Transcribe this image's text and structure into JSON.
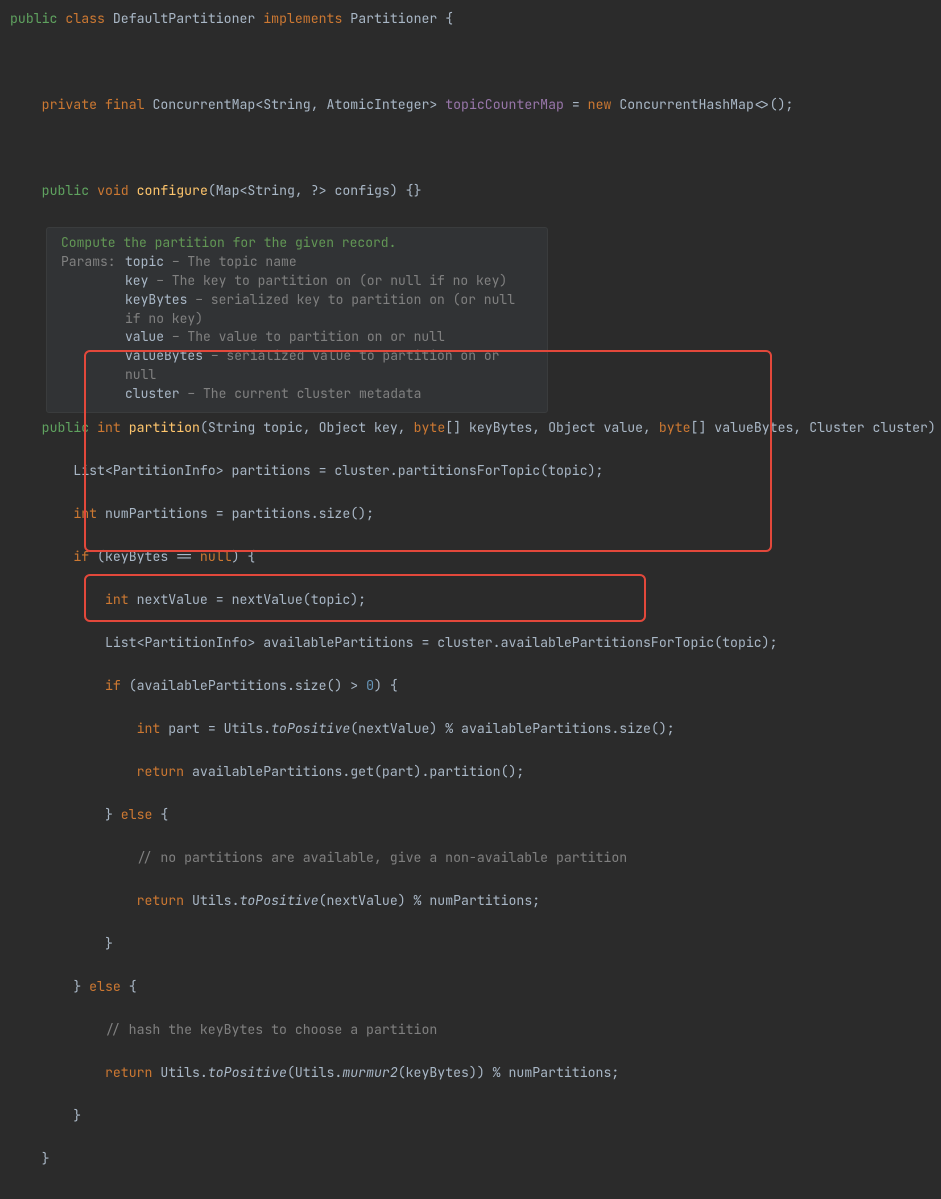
{
  "classDecl": {
    "public": "public",
    "class": "class",
    "name": "DefaultPartitioner",
    "implements": "implements",
    "iface": "Partitioner",
    "open": " {"
  },
  "fieldDecl": {
    "private": "private",
    "final": "final",
    "type": "ConcurrentMap<String, AtomicInteger>",
    "name": "topicCounterMap",
    "eq": " = ",
    "new": "new",
    "ctor": "ConcurrentHashMap<>();"
  },
  "configure": {
    "public": "public",
    "void": "void",
    "name": "configure",
    "params": "(Map<String, ?> configs) {}"
  },
  "javadoc": {
    "summary": "Compute the partition for the given record.",
    "paramsLabel": "Params:",
    "p1name": "topic",
    "p1desc": " – The topic name",
    "p2name": "key",
    "p2desc": " – The key to partition on (or null if no key)",
    "p3name": "keyBytes",
    "p3desc": " – serialized key to partition on (or null if no key)",
    "p4name": "value",
    "p4desc": " – The value to partition on or null",
    "p5name": "valueBytes",
    "p5desc": " – serialized value to partition on or null",
    "p6name": "cluster",
    "p6desc": " – The current cluster metadata"
  },
  "sig": {
    "public": "public",
    "int": "int",
    "name": "partition",
    "seg1": "(String topic, Object key, ",
    "byte1": "byte",
    "seg2": "[] keyBytes, Object value, ",
    "byte2": "byte",
    "seg3": "[] valueBytes, Cluster cluster) {"
  },
  "body": {
    "l1": "        List<PartitionInfo> partitions = cluster.partitionsForTopic(topic);",
    "l2a": "int",
    "l2b": " numPartitions = partitions.size();",
    "l3a": "if",
    "l3b": " (keyBytes == ",
    "l3c": "null",
    "l3d": ") {",
    "l4a": "int",
    "l4b": " nextValue = nextValue(topic);",
    "l5": "            List<PartitionInfo> availablePartitions = cluster.availablePartitionsForTopic(topic);",
    "l6a": "if",
    "l6b": " (availablePartitions.size() > ",
    "l6c": "0",
    "l6d": ") {",
    "l7a": "int",
    "l7b": " part = Utils.",
    "l7c": "toPositive",
    "l7d": "(nextValue) % availablePartitions.size();",
    "l8a": "return",
    "l8b": " availablePartitions.get(part).partition();",
    "l9a": "} ",
    "l9b": "else",
    "l9c": " {",
    "l10": "                // no partitions are available, give a non-available partition",
    "l11a": "return",
    "l11b": " Utils.",
    "l11c": "toPositive",
    "l11d": "(nextValue) % numPartitions;",
    "l12": "            }",
    "l13a": "} ",
    "l13b": "else",
    "l13c": " {",
    "l14": "            // hash the keyBytes to choose a partition",
    "l15a": "return",
    "l15b": " Utils.",
    "l15c": "toPositive",
    "l15d": "(Utils.",
    "l15e": "murmur2",
    "l15f": "(keyBytes)) % numPartitions;",
    "l16": "        }",
    "l17": "    }"
  }
}
